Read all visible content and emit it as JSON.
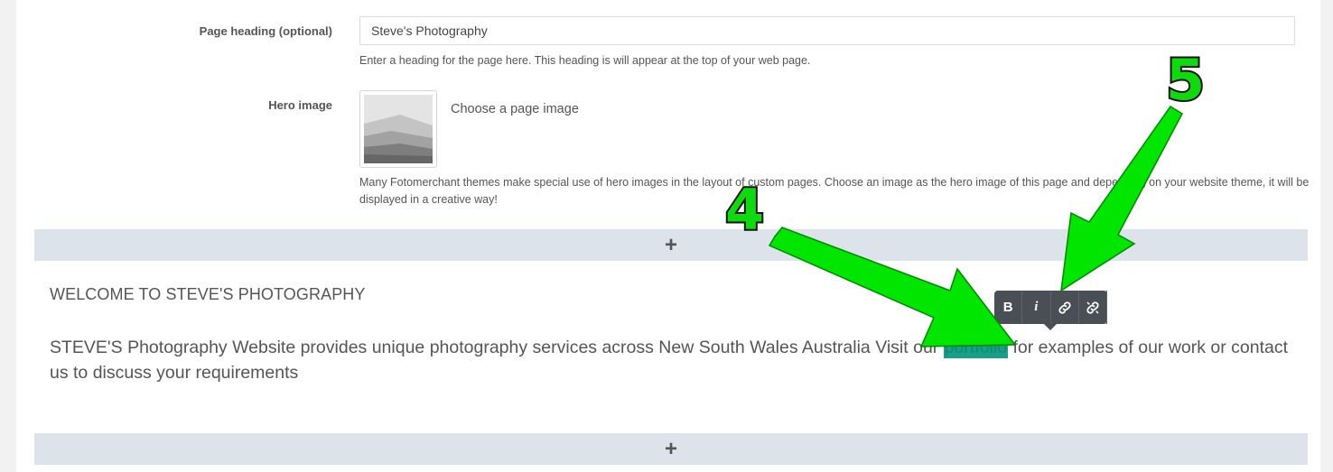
{
  "page_heading": {
    "label": "Page heading (optional)",
    "value": "Steve's Photography",
    "help": "Enter a heading for the page here. This heading is will appear at the top of your web page."
  },
  "hero_image": {
    "label": "Hero image",
    "choose_label": "Choose a page image",
    "help": "Many Fotomerchant themes make special use of hero images in the layout of custom pages. Choose an image as the hero image of this page and depending on your website theme, it will be displayed in a creative way!"
  },
  "add_block_label": "+",
  "content": {
    "heading": "WELCOME TO STEVE'S PHOTOGRAPHY",
    "para_before": "STEVE'S Photography Website provides unique photography services across New South Wales Australia Visit our ",
    "para_link": "portfolio",
    "para_after": " for examples of our work or contact us to discuss your requirements"
  },
  "toolbar": {
    "bold_label": "B",
    "italic_label": "i",
    "link_icon": "link-icon",
    "unlink_icon": "unlink-icon"
  },
  "annotations": {
    "step4": "4",
    "step5": "5",
    "arrow_color": "#00e600"
  },
  "colors": {
    "highlight": "#16a085",
    "toolbar_bg": "#4a4f56",
    "add_bar_bg": "#dde3eb"
  }
}
